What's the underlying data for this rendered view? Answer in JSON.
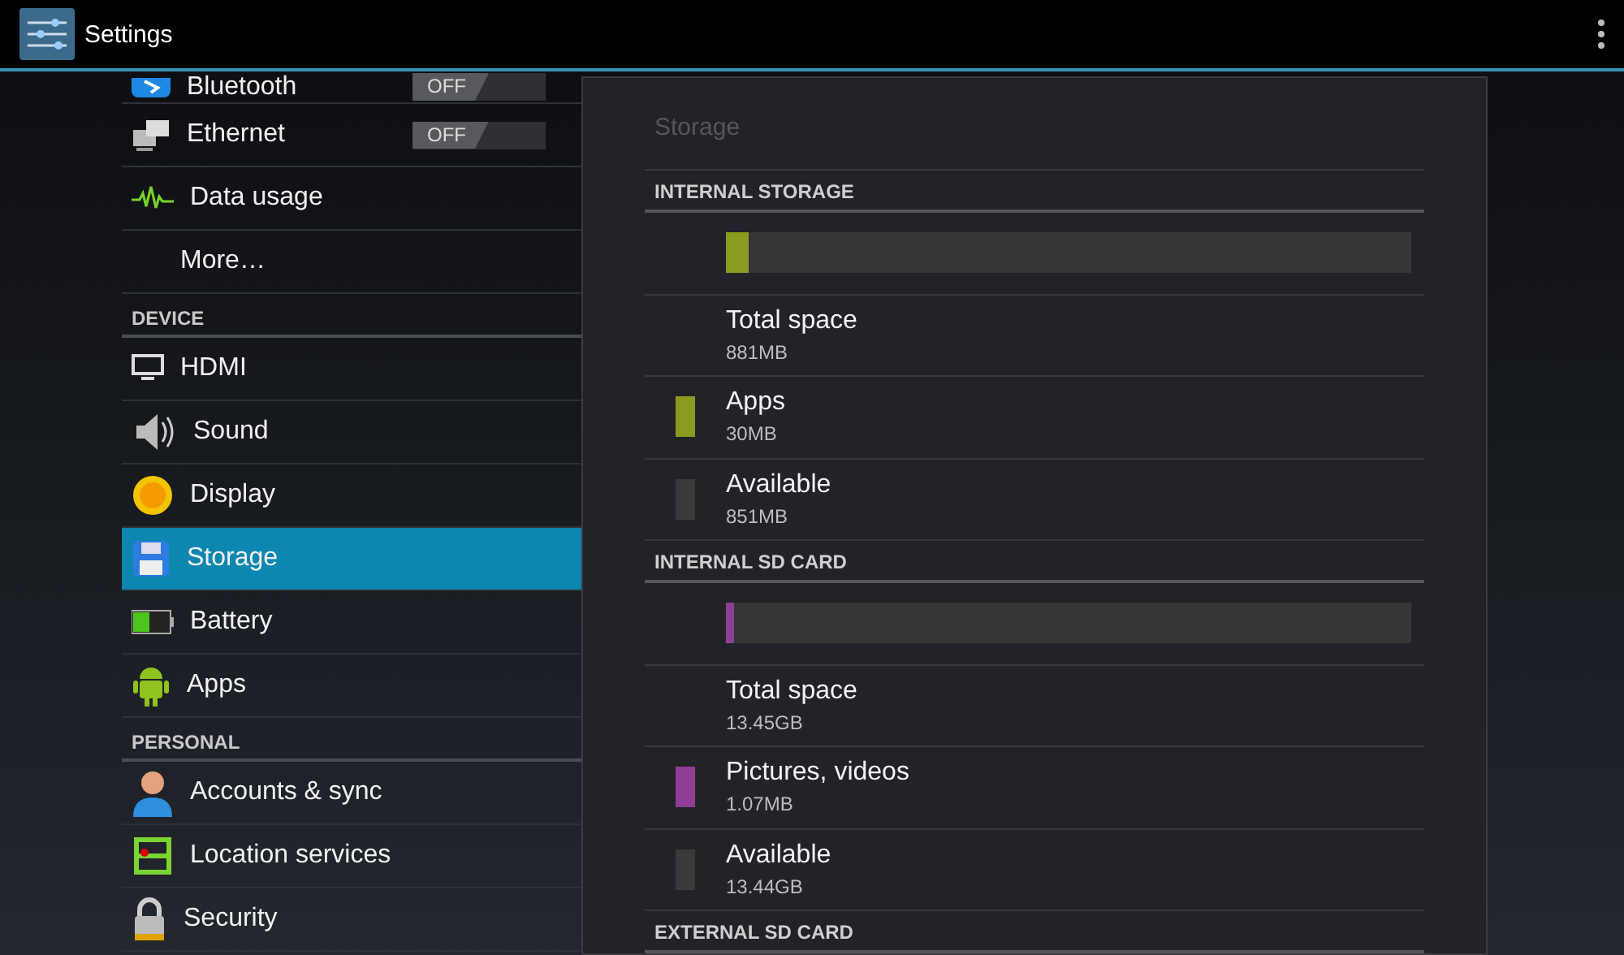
{
  "app_bar": {
    "title": "Settings"
  },
  "sidebar": {
    "items": [
      {
        "kind": "toggle",
        "label": "Bluetooth",
        "selected": false,
        "switch": {
          "text": "OFF",
          "on": false
        }
      },
      {
        "kind": "toggle",
        "label": "Ethernet",
        "selected": false,
        "switch": {
          "text": "OFF",
          "on": false
        }
      },
      {
        "kind": "link",
        "label": "Data usage",
        "selected": false
      },
      {
        "kind": "link",
        "label": "More…",
        "selected": false
      },
      {
        "kind": "header",
        "label": "DEVICE"
      },
      {
        "kind": "link",
        "label": "HDMI",
        "selected": false
      },
      {
        "kind": "link",
        "label": "Sound",
        "selected": false
      },
      {
        "kind": "link",
        "label": "Display",
        "selected": false
      },
      {
        "kind": "link",
        "label": "Storage",
        "selected": true
      },
      {
        "kind": "link",
        "label": "Battery",
        "selected": false
      },
      {
        "kind": "link",
        "label": "Apps",
        "selected": false
      },
      {
        "kind": "header",
        "label": "PERSONAL"
      },
      {
        "kind": "link",
        "label": "Accounts & sync",
        "selected": false
      },
      {
        "kind": "link",
        "label": "Location services",
        "selected": false
      },
      {
        "kind": "link",
        "label": "Security",
        "selected": false
      }
    ]
  },
  "panel": {
    "title": "Storage",
    "sections": [
      {
        "header": "INTERNAL STORAGE",
        "bar": [
          {
            "level": 0.034,
            "color": "#8c9a1f"
          }
        ],
        "rows": [
          {
            "label": "Total space",
            "value": "881MB"
          },
          {
            "label": "Apps",
            "value": "30MB",
            "color": "#8c9a1f"
          },
          {
            "label": "Available",
            "value": "851MB",
            "color": "#3a3a3a"
          }
        ]
      },
      {
        "header": "INTERNAL SD CARD",
        "bar": [
          {
            "level": 0.012,
            "color": "#8e3f94"
          }
        ],
        "rows": [
          {
            "label": "Total space",
            "value": "13.45GB"
          },
          {
            "label": "Pictures, videos",
            "value": "1.07MB",
            "color": "#8e3f94"
          },
          {
            "label": "Available",
            "value": "13.44GB",
            "color": "#3a3a3a"
          }
        ]
      },
      {
        "header": "EXTERNAL SD CARD"
      }
    ]
  }
}
